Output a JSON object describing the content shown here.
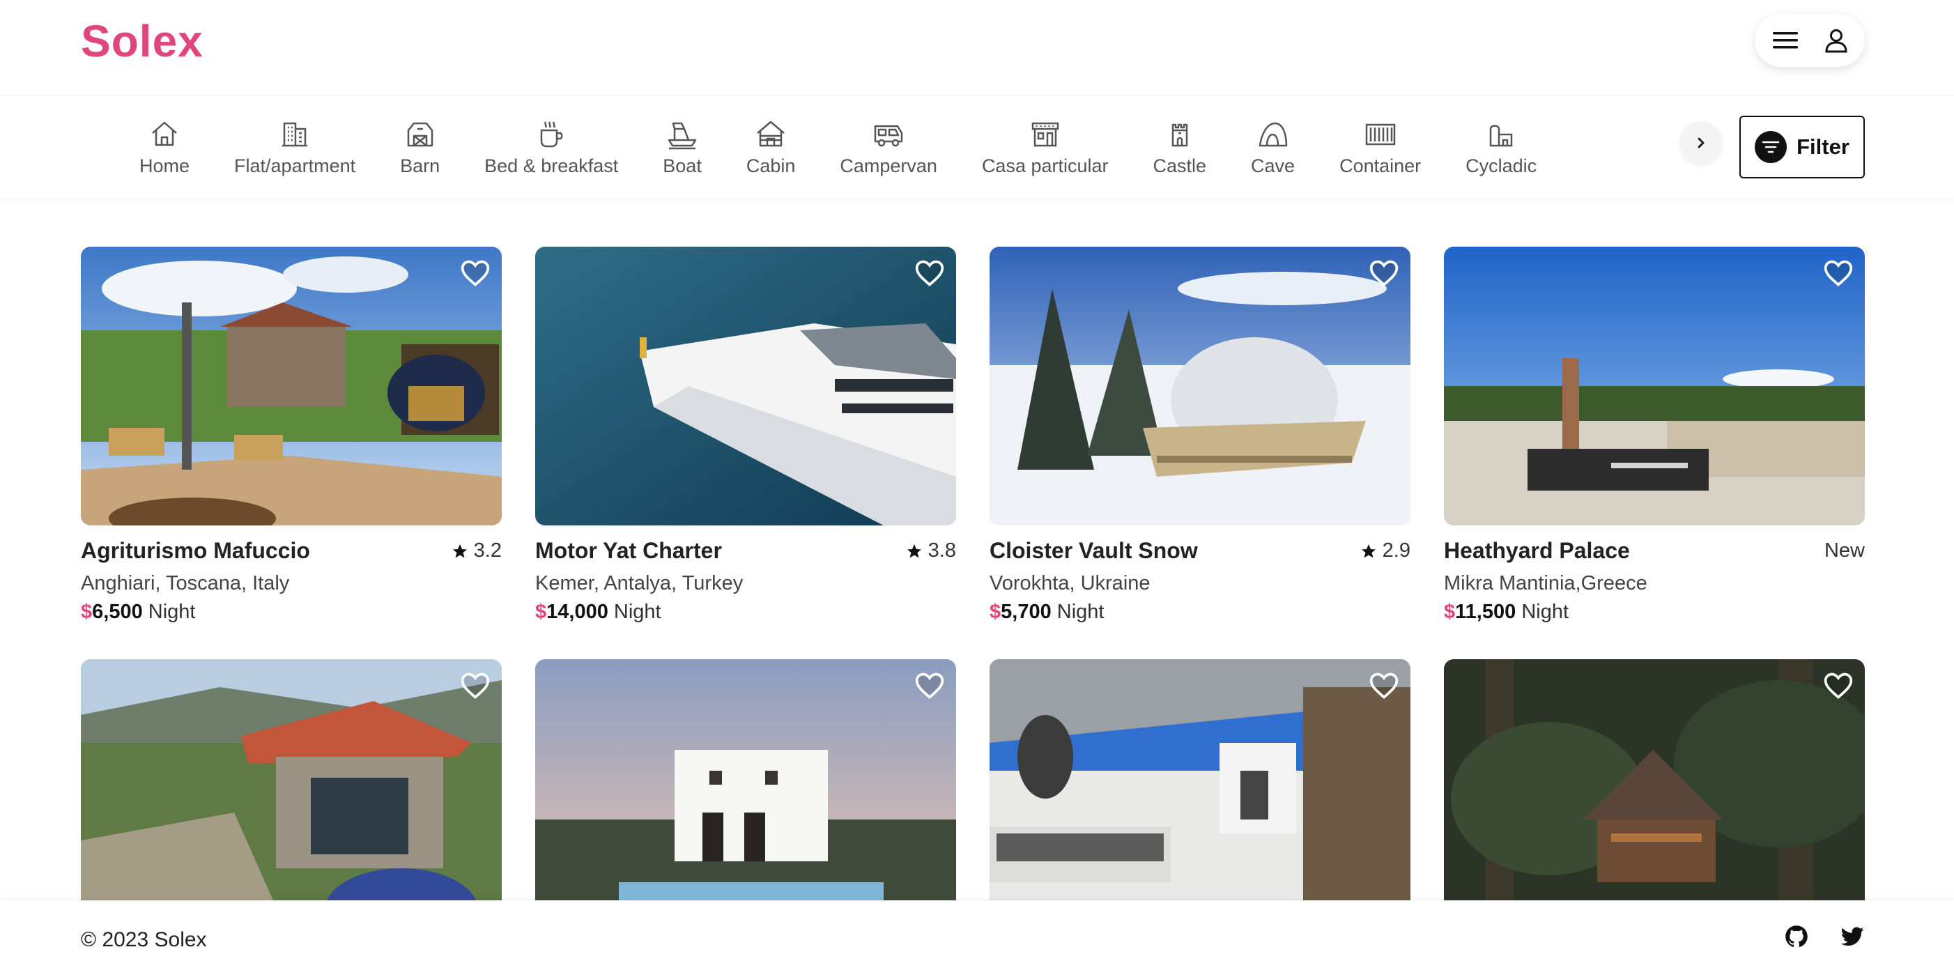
{
  "brand": {
    "logo": "Solex",
    "accent": "#e0457b"
  },
  "header": {
    "menu_icon": "hamburger-menu-icon",
    "user_icon": "user-icon"
  },
  "categories": [
    {
      "label": "Home",
      "icon": "home-icon"
    },
    {
      "label": "Flat/apartment",
      "icon": "building-icon"
    },
    {
      "label": "Barn",
      "icon": "barn-icon"
    },
    {
      "label": "Bed & breakfast",
      "icon": "coffee-icon"
    },
    {
      "label": "Boat",
      "icon": "boat-icon"
    },
    {
      "label": "Cabin",
      "icon": "cabin-icon"
    },
    {
      "label": "Campervan",
      "icon": "campervan-icon"
    },
    {
      "label": "Casa particular",
      "icon": "casa-icon"
    },
    {
      "label": "Castle",
      "icon": "castle-icon"
    },
    {
      "label": "Cave",
      "icon": "cave-icon"
    },
    {
      "label": "Container",
      "icon": "container-icon"
    },
    {
      "label": "Cycladic",
      "icon": "cycladic-icon"
    }
  ],
  "filter": {
    "label": "Filter",
    "icon": "filter-icon"
  },
  "listings": [
    {
      "title": "Agriturismo Mafuccio",
      "rating": "3.2",
      "location": "Anghiari, Toscana, Italy",
      "currency": "$",
      "price": "6,500",
      "unit": "Night"
    },
    {
      "title": "Motor Yat Charter",
      "rating": "3.8",
      "location": "Kemer, Antalya, Turkey",
      "currency": "$",
      "price": "14,000",
      "unit": "Night"
    },
    {
      "title": "Cloister Vault Snow",
      "rating": "2.9",
      "location": "Vorokhta, Ukraine",
      "currency": "$",
      "price": "5,700",
      "unit": "Night"
    },
    {
      "title": "Heathyard Palace",
      "rating": "New",
      "location": "Mikra Mantinia,Greece",
      "currency": "$",
      "price": "11,500",
      "unit": "Night"
    }
  ],
  "footer": {
    "copyright": "© 2023 Solex",
    "icons": [
      "github-icon",
      "twitter-icon"
    ]
  }
}
